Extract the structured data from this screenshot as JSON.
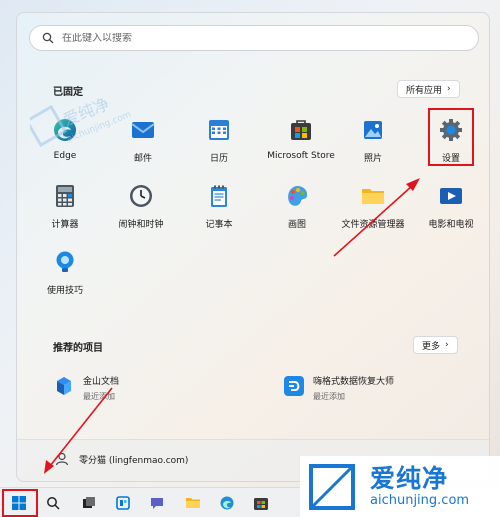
{
  "search": {
    "placeholder": "在此键入以搜索"
  },
  "pinned": {
    "title": "已固定",
    "all_apps_label": "所有应用",
    "apps": [
      {
        "label": "Edge",
        "icon": "edge-icon"
      },
      {
        "label": "邮件",
        "icon": "mail-icon"
      },
      {
        "label": "日历",
        "icon": "calendar-icon"
      },
      {
        "label": "Microsoft Store",
        "icon": "store-icon"
      },
      {
        "label": "照片",
        "icon": "photos-icon"
      },
      {
        "label": "设置",
        "icon": "gear-icon"
      },
      {
        "label": "计算器",
        "icon": "calculator-icon"
      },
      {
        "label": "闹钟和时钟",
        "icon": "clock-icon"
      },
      {
        "label": "记事本",
        "icon": "notepad-icon"
      },
      {
        "label": "画图",
        "icon": "paint-icon"
      },
      {
        "label": "文件资源管理器",
        "icon": "folder-icon"
      },
      {
        "label": "电影和电视",
        "icon": "movies-icon"
      },
      {
        "label": "使用技巧",
        "icon": "tips-icon"
      }
    ]
  },
  "recommended": {
    "title": "推荐的项目",
    "more_label": "更多",
    "items": [
      {
        "title": "金山文档",
        "subtitle": "最近添加",
        "icon": "kdocs-icon"
      },
      {
        "title": "嗨格式数据恢复大师",
        "subtitle": "最近添加",
        "icon": "recovery-icon"
      }
    ]
  },
  "footer": {
    "user_name": "零分猫 (lingfenmao.com)"
  },
  "watermark": {
    "brand": "爱纯净",
    "domain": "aichunjing.com"
  },
  "colors": {
    "highlight": "#e0141e",
    "accent": "#0078d4"
  }
}
